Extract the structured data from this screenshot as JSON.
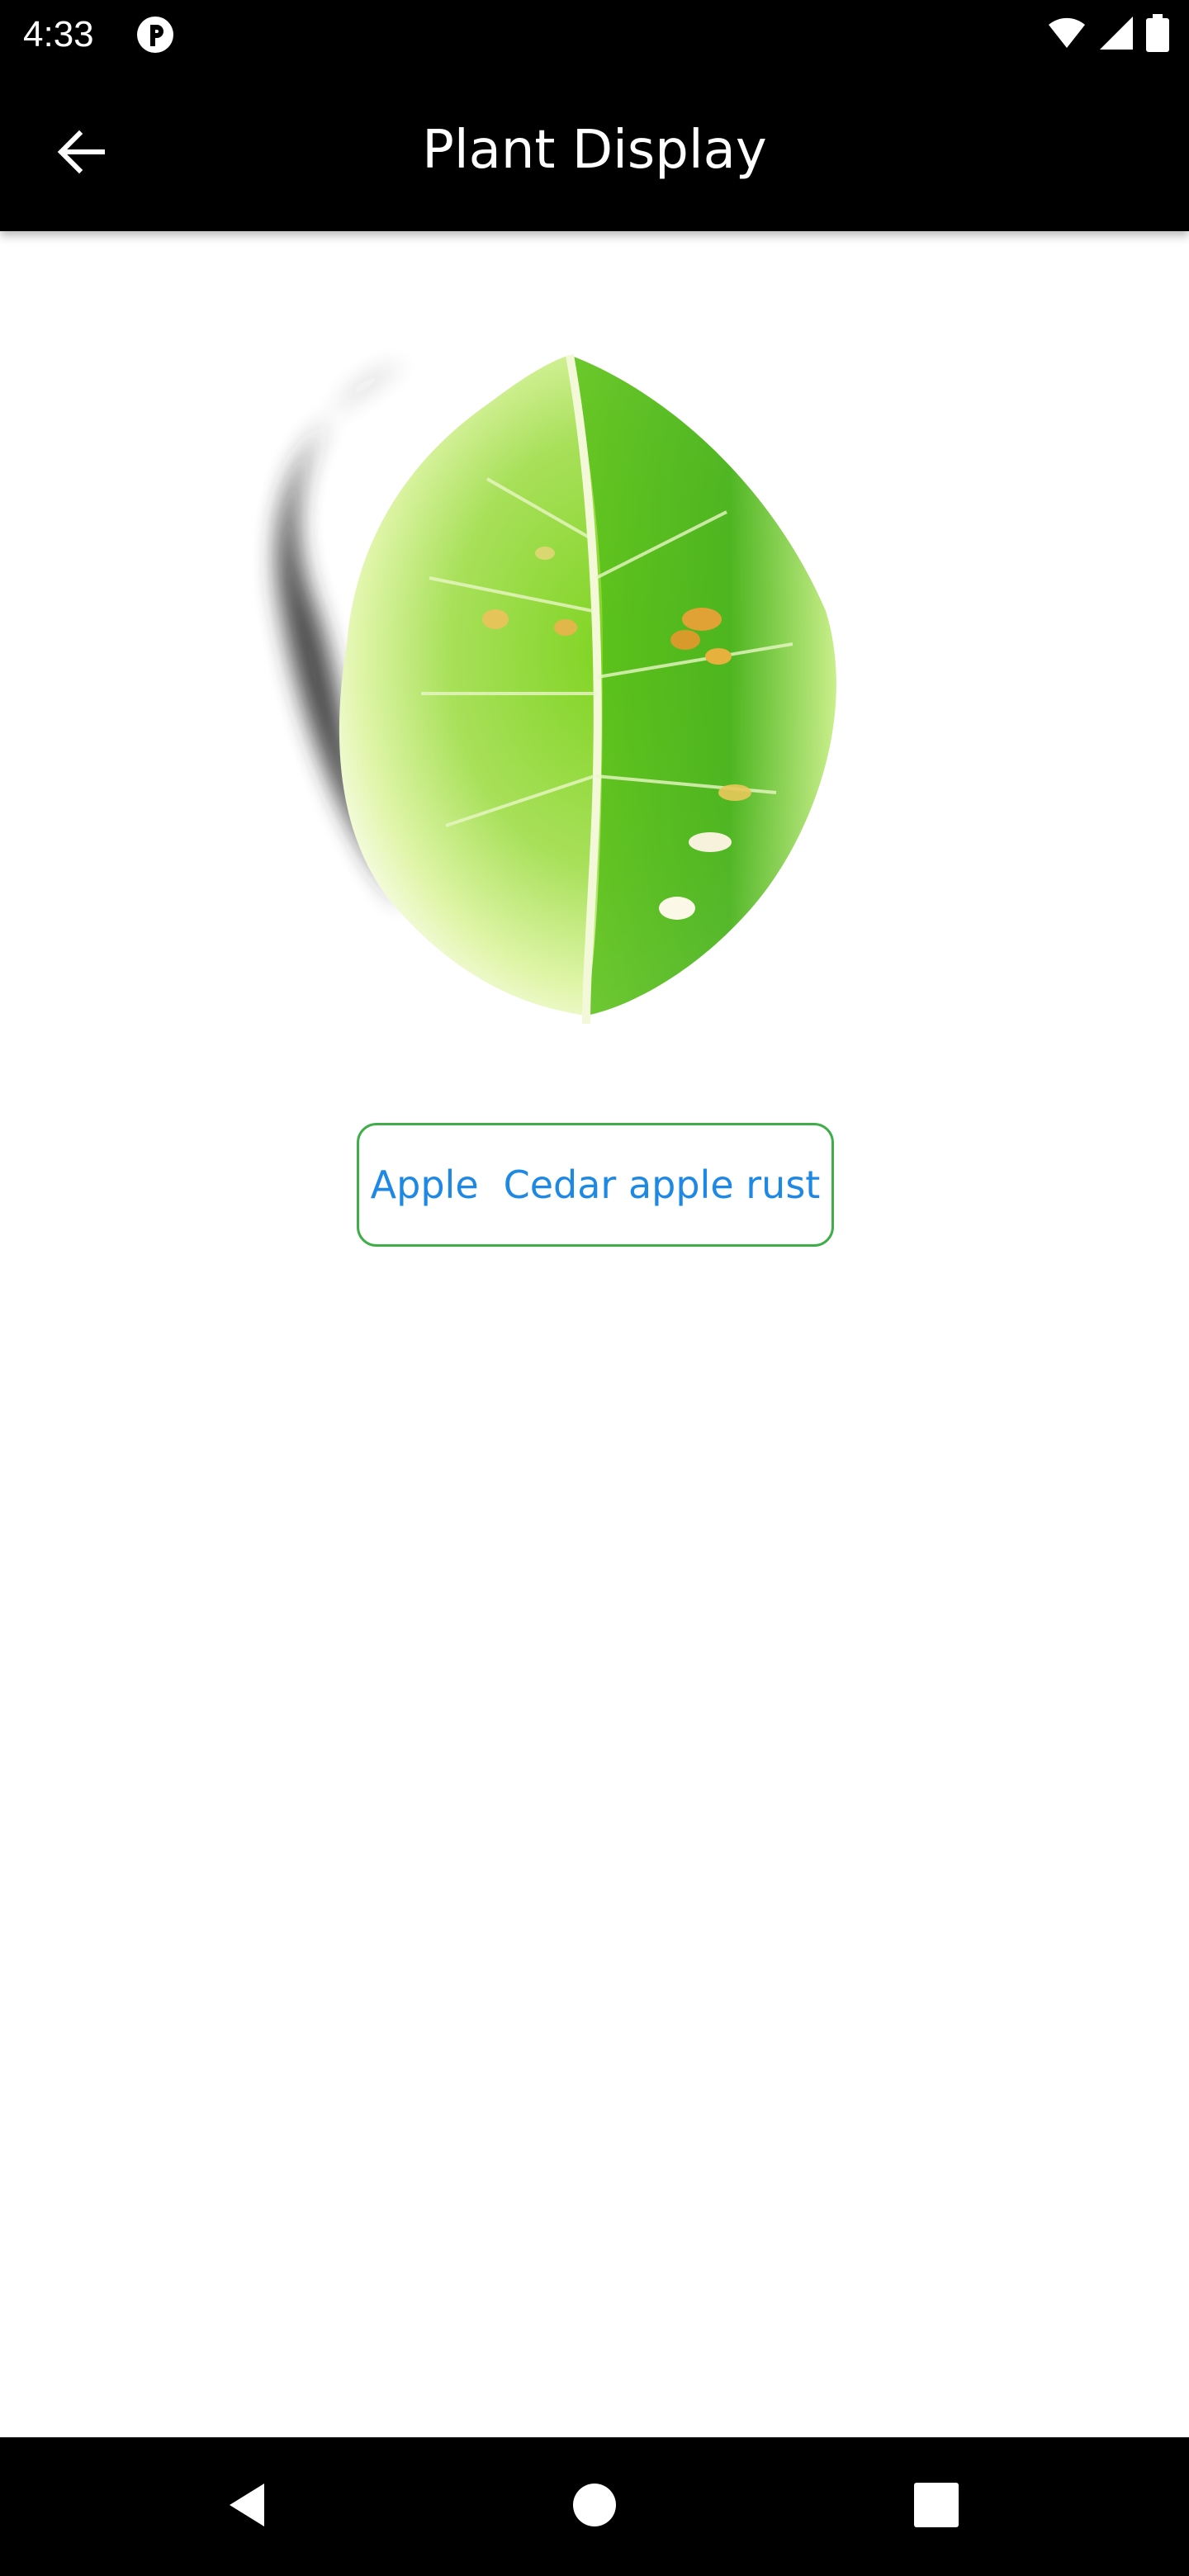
{
  "status_bar": {
    "time": "4:33",
    "app_icon": "app-notification-icon",
    "icons": [
      "wifi-icon",
      "signal-icon",
      "battery-icon"
    ]
  },
  "app_bar": {
    "title": "Plant Display",
    "back_icon": "arrow-back-icon"
  },
  "main": {
    "image_subject": "leaf-image",
    "result": {
      "plant": "Apple",
      "disease": "Cedar apple rust"
    }
  },
  "nav_bar": {
    "icons": [
      "back-triangle-icon",
      "home-circle-icon",
      "recents-square-icon"
    ]
  },
  "colors": {
    "bar_background": "#000000",
    "result_border": "#3fae49",
    "result_text": "#1e88e5"
  }
}
